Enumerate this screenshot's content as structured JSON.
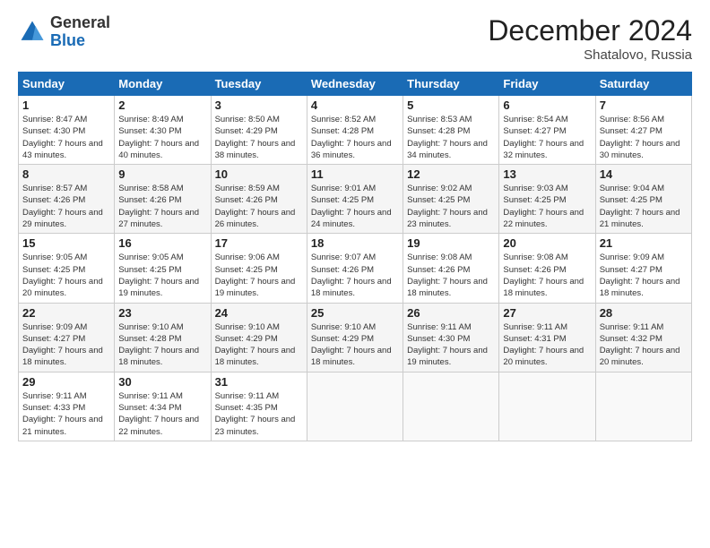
{
  "header": {
    "logo_general": "General",
    "logo_blue": "Blue",
    "month_title": "December 2024",
    "subtitle": "Shatalovo, Russia"
  },
  "weekdays": [
    "Sunday",
    "Monday",
    "Tuesday",
    "Wednesday",
    "Thursday",
    "Friday",
    "Saturday"
  ],
  "weeks": [
    [
      {
        "day": "1",
        "sunrise": "8:47 AM",
        "sunset": "4:30 PM",
        "daylight": "7 hours and 43 minutes."
      },
      {
        "day": "2",
        "sunrise": "8:49 AM",
        "sunset": "4:30 PM",
        "daylight": "7 hours and 40 minutes."
      },
      {
        "day": "3",
        "sunrise": "8:50 AM",
        "sunset": "4:29 PM",
        "daylight": "7 hours and 38 minutes."
      },
      {
        "day": "4",
        "sunrise": "8:52 AM",
        "sunset": "4:28 PM",
        "daylight": "7 hours and 36 minutes."
      },
      {
        "day": "5",
        "sunrise": "8:53 AM",
        "sunset": "4:28 PM",
        "daylight": "7 hours and 34 minutes."
      },
      {
        "day": "6",
        "sunrise": "8:54 AM",
        "sunset": "4:27 PM",
        "daylight": "7 hours and 32 minutes."
      },
      {
        "day": "7",
        "sunrise": "8:56 AM",
        "sunset": "4:27 PM",
        "daylight": "7 hours and 30 minutes."
      }
    ],
    [
      {
        "day": "8",
        "sunrise": "8:57 AM",
        "sunset": "4:26 PM",
        "daylight": "7 hours and 29 minutes."
      },
      {
        "day": "9",
        "sunrise": "8:58 AM",
        "sunset": "4:26 PM",
        "daylight": "7 hours and 27 minutes."
      },
      {
        "day": "10",
        "sunrise": "8:59 AM",
        "sunset": "4:26 PM",
        "daylight": "7 hours and 26 minutes."
      },
      {
        "day": "11",
        "sunrise": "9:01 AM",
        "sunset": "4:25 PM",
        "daylight": "7 hours and 24 minutes."
      },
      {
        "day": "12",
        "sunrise": "9:02 AM",
        "sunset": "4:25 PM",
        "daylight": "7 hours and 23 minutes."
      },
      {
        "day": "13",
        "sunrise": "9:03 AM",
        "sunset": "4:25 PM",
        "daylight": "7 hours and 22 minutes."
      },
      {
        "day": "14",
        "sunrise": "9:04 AM",
        "sunset": "4:25 PM",
        "daylight": "7 hours and 21 minutes."
      }
    ],
    [
      {
        "day": "15",
        "sunrise": "9:05 AM",
        "sunset": "4:25 PM",
        "daylight": "7 hours and 20 minutes."
      },
      {
        "day": "16",
        "sunrise": "9:05 AM",
        "sunset": "4:25 PM",
        "daylight": "7 hours and 19 minutes."
      },
      {
        "day": "17",
        "sunrise": "9:06 AM",
        "sunset": "4:25 PM",
        "daylight": "7 hours and 19 minutes."
      },
      {
        "day": "18",
        "sunrise": "9:07 AM",
        "sunset": "4:26 PM",
        "daylight": "7 hours and 18 minutes."
      },
      {
        "day": "19",
        "sunrise": "9:08 AM",
        "sunset": "4:26 PM",
        "daylight": "7 hours and 18 minutes."
      },
      {
        "day": "20",
        "sunrise": "9:08 AM",
        "sunset": "4:26 PM",
        "daylight": "7 hours and 18 minutes."
      },
      {
        "day": "21",
        "sunrise": "9:09 AM",
        "sunset": "4:27 PM",
        "daylight": "7 hours and 18 minutes."
      }
    ],
    [
      {
        "day": "22",
        "sunrise": "9:09 AM",
        "sunset": "4:27 PM",
        "daylight": "7 hours and 18 minutes."
      },
      {
        "day": "23",
        "sunrise": "9:10 AM",
        "sunset": "4:28 PM",
        "daylight": "7 hours and 18 minutes."
      },
      {
        "day": "24",
        "sunrise": "9:10 AM",
        "sunset": "4:29 PM",
        "daylight": "7 hours and 18 minutes."
      },
      {
        "day": "25",
        "sunrise": "9:10 AM",
        "sunset": "4:29 PM",
        "daylight": "7 hours and 18 minutes."
      },
      {
        "day": "26",
        "sunrise": "9:11 AM",
        "sunset": "4:30 PM",
        "daylight": "7 hours and 19 minutes."
      },
      {
        "day": "27",
        "sunrise": "9:11 AM",
        "sunset": "4:31 PM",
        "daylight": "7 hours and 20 minutes."
      },
      {
        "day": "28",
        "sunrise": "9:11 AM",
        "sunset": "4:32 PM",
        "daylight": "7 hours and 20 minutes."
      }
    ],
    [
      {
        "day": "29",
        "sunrise": "9:11 AM",
        "sunset": "4:33 PM",
        "daylight": "7 hours and 21 minutes."
      },
      {
        "day": "30",
        "sunrise": "9:11 AM",
        "sunset": "4:34 PM",
        "daylight": "7 hours and 22 minutes."
      },
      {
        "day": "31",
        "sunrise": "9:11 AM",
        "sunset": "4:35 PM",
        "daylight": "7 hours and 23 minutes."
      },
      null,
      null,
      null,
      null
    ]
  ],
  "labels": {
    "sunrise": "Sunrise:",
    "sunset": "Sunset:",
    "daylight": "Daylight:"
  }
}
